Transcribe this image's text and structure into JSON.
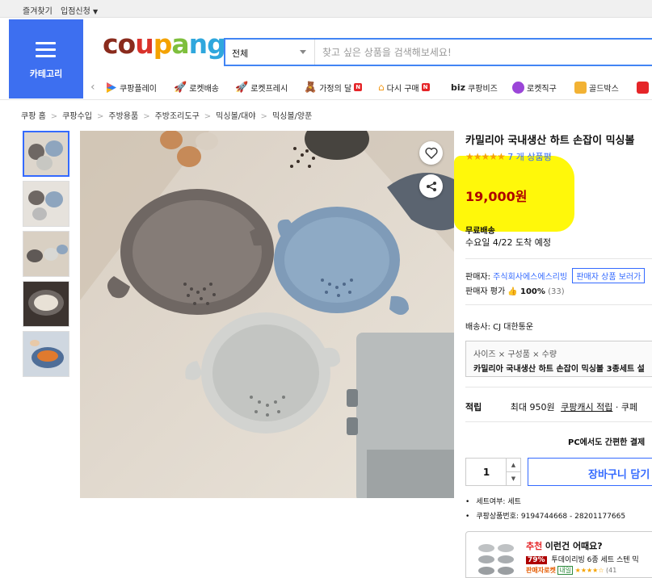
{
  "topbar": {
    "favorites": "즐겨찾기",
    "seller_apply": "입점신청"
  },
  "category": {
    "label": "카테고리"
  },
  "logo": {
    "c1": "co",
    "c2": "u",
    "c3": "p",
    "c4": "a",
    "c5": "ng"
  },
  "search": {
    "scope": "전체",
    "placeholder": "찾고 싶은 상품을 검색해보세요!"
  },
  "quicknav": {
    "items": [
      {
        "label": "쿠팡플레이",
        "icon": "coupang-play-icon"
      },
      {
        "label": "로켓배송",
        "icon": "rocket-icon"
      },
      {
        "label": "로켓프레시",
        "icon": "rocket-fresh-icon"
      },
      {
        "label": "가정의 달",
        "icon": "bear-icon",
        "badge": "N"
      },
      {
        "label": "다시 구매",
        "icon": "rebuy-icon",
        "badge": "N"
      },
      {
        "label": "쿠팡비즈",
        "prefix": "biz"
      },
      {
        "label": "로켓직구",
        "icon": "rocket-global-icon"
      },
      {
        "label": "골드박스",
        "icon": "goldbox-icon"
      }
    ]
  },
  "breadcrumb": [
    "쿠팡 홈",
    "쿠팡수입",
    "주방용품",
    "주방조리도구",
    "믹싱볼/대야",
    "믹싱볼/양푼"
  ],
  "product": {
    "title": "카밀리아 국내생산 하트 손잡이 믹싱볼",
    "stars": "★★★★★",
    "review_count": "7 개 상품평",
    "price": "19,000원",
    "shipping": "무료배송",
    "delivery": "수요일 4/22 도착 예정",
    "seller_label": "판매자:",
    "seller_name": "주식회사에스에스리빙",
    "seller_button": "판매자 상품 보러가",
    "seller_rating_label": "판매자 평가",
    "seller_rating": "100%",
    "seller_rating_count": "(33)",
    "carrier_label": "배송사:",
    "carrier": "CJ 대한통운",
    "option_path": "사이즈 × 구성품 × 수량",
    "option_value": "카밀리아 국내생산 하트 손잡이 믹싱볼 3종세트 설",
    "points_label": "적립",
    "points_max": "최대 950원",
    "points_link": "쿠팡캐시 적립",
    "points_more": "· 쿠페",
    "pc_notice": "PC에서도 간편한 결제",
    "quantity": "1",
    "cart_button": "장바구니 담기",
    "attr_set": "세트여부: 세트",
    "attr_id": "쿠팡상품번호: 9194744668 - 28201177665"
  },
  "reco": {
    "prefix": "추천",
    "title": "이런건 어때요?",
    "discount": "79%",
    "name": "투데이리빙 6종 세트 스텐 믹",
    "badge": "판매자로켓",
    "badge2": "내일",
    "count": "(41"
  },
  "colors": {
    "accent": "#346aff",
    "price": "#ae0000",
    "category_bg": "#3d6ff0",
    "highlight": "#fff800"
  }
}
